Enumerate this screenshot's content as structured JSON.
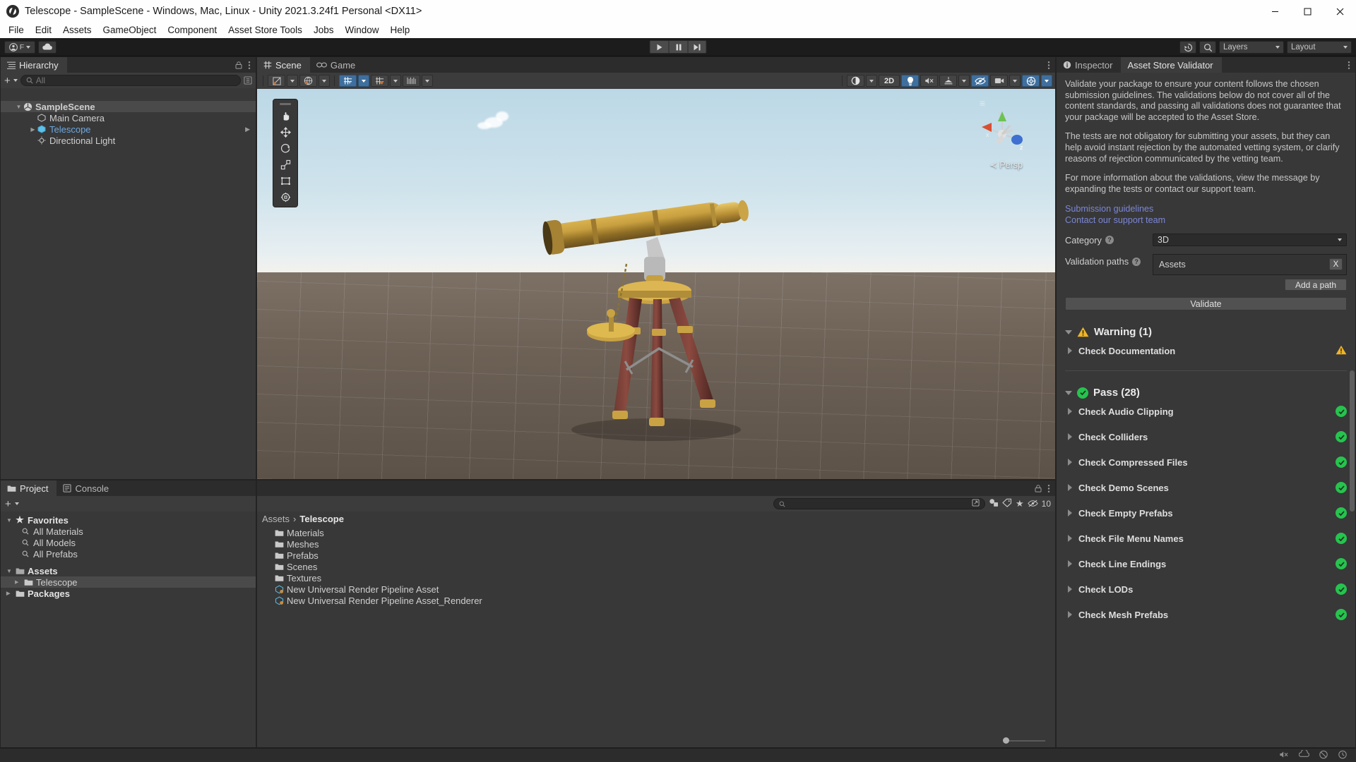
{
  "window": {
    "title": "Telescope - SampleScene - Windows, Mac, Linux - Unity 2021.3.24f1 Personal <DX11>",
    "logo_icon": "unity-logo-icon",
    "minimize_icon": "minimize-icon",
    "maximize_icon": "maximize-icon",
    "close_icon": "close-icon"
  },
  "menubar": {
    "items": [
      "File",
      "Edit",
      "Assets",
      "GameObject",
      "Component",
      "Asset Store Tools",
      "Jobs",
      "Window",
      "Help"
    ]
  },
  "toolbar": {
    "account_label": "F",
    "account_icon": "account-icon",
    "cloud_icon": "cloud-icon",
    "play_icon": "play-icon",
    "pause_icon": "pause-icon",
    "step_icon": "step-icon",
    "history_icon": "undo-history-icon",
    "search_icon": "search-icon",
    "layers_label": "Layers",
    "layout_label": "Layout"
  },
  "hierarchy": {
    "tab_label": "Hierarchy",
    "tab_icon": "hierarchy-icon",
    "lock_icon": "lock-icon",
    "menu_icon": "kebab-menu-icon",
    "add_icon": "plus-icon",
    "search_placeholder": "All",
    "search_icon": "search-icon",
    "items": [
      {
        "label": "SampleScene",
        "icon": "scene-icon",
        "depth": 0,
        "expanded": true,
        "selected": true,
        "blue": false
      },
      {
        "label": "Main Camera",
        "icon": "gameobject-icon",
        "depth": 1,
        "expanded": null,
        "selected": false,
        "blue": false
      },
      {
        "label": "Telescope",
        "icon": "prefab-icon",
        "depth": 1,
        "expanded": false,
        "selected": false,
        "blue": true
      },
      {
        "label": "Directional Light",
        "icon": "gameobject-icon",
        "depth": 1,
        "expanded": null,
        "selected": false,
        "blue": false
      }
    ]
  },
  "scene": {
    "tabs": [
      {
        "label": "Scene",
        "icon": "scene-grid-icon",
        "active": true
      },
      {
        "label": "Game",
        "icon": "game-icon",
        "active": false
      }
    ],
    "menu_icon": "kebab-menu-icon",
    "left_tools": [
      {
        "name": "draw-mode-icon",
        "dropdown": true,
        "active": false
      },
      {
        "name": "shading-globe-icon",
        "dropdown": true,
        "active": false
      },
      {
        "name": "grid-2d-y-icon",
        "dropdown": true,
        "active": true
      },
      {
        "name": "snap-grid-icon",
        "dropdown": true,
        "active": false
      },
      {
        "name": "grid-scale-icon",
        "dropdown": true,
        "active": false
      }
    ],
    "right_tools": [
      {
        "name": "gizmo-shading-icon",
        "label": "",
        "dropdown": true,
        "active": false
      },
      {
        "name": "toggle-2d-button",
        "label": "2D",
        "dropdown": false,
        "active": false
      },
      {
        "name": "scene-lighting-icon",
        "label": "",
        "dropdown": false,
        "active": true
      },
      {
        "name": "audio-mute-icon",
        "label": "",
        "dropdown": false,
        "active": false
      },
      {
        "name": "fx-effects-icon",
        "label": "",
        "dropdown": true,
        "active": false
      },
      {
        "name": "scene-visibility-icon",
        "label": "",
        "dropdown": false,
        "active": true
      },
      {
        "name": "camera-overlay-icon",
        "label": "",
        "dropdown": true,
        "active": false
      },
      {
        "name": "gizmos-toggle-icon",
        "label": "",
        "dropdown": true,
        "active": true
      }
    ],
    "tool_palette": [
      {
        "name": "hand-tool",
        "active": false
      },
      {
        "name": "move-tool",
        "active": false
      },
      {
        "name": "rotate-tool",
        "active": false
      },
      {
        "name": "scale-tool",
        "active": false
      },
      {
        "name": "rect-tool",
        "active": false
      },
      {
        "name": "transform-tool",
        "active": false
      }
    ],
    "gizmo": {
      "x_label": "x",
      "y_label": "y",
      "z_label": "z",
      "projection": "Persp"
    }
  },
  "project": {
    "tabs": [
      {
        "label": "Project",
        "icon": "folder-icon",
        "active": true
      },
      {
        "label": "Console",
        "icon": "console-icon",
        "active": false
      }
    ],
    "lock_icon": "lock-icon",
    "menu_icon": "kebab-menu-icon",
    "add_icon": "plus-icon",
    "search_placeholder": "",
    "search_icon": "search-icon",
    "filter_icons": [
      "save-search-icon",
      "filter-type-icon",
      "filter-label-icon",
      "favorite-star-icon",
      "visibility-icon"
    ],
    "hidden_count": "10",
    "tree": [
      {
        "label": "Favorites",
        "icon": "star-icon",
        "depth": 0,
        "bold": true,
        "expanded": true,
        "selected": false
      },
      {
        "label": "All Materials",
        "icon": "search-icon",
        "depth": 1,
        "bold": false,
        "expanded": null,
        "selected": false
      },
      {
        "label": "All Models",
        "icon": "search-icon",
        "depth": 1,
        "bold": false,
        "expanded": null,
        "selected": false
      },
      {
        "label": "All Prefabs",
        "icon": "search-icon",
        "depth": 1,
        "bold": false,
        "expanded": null,
        "selected": false
      },
      {
        "label": "Assets",
        "icon": "folder-open-icon",
        "depth": 0,
        "bold": true,
        "expanded": true,
        "selected": false
      },
      {
        "label": "Telescope",
        "icon": "folder-icon",
        "depth": 1,
        "bold": false,
        "expanded": false,
        "selected": true
      },
      {
        "label": "Packages",
        "icon": "folder-icon",
        "depth": 0,
        "bold": true,
        "expanded": false,
        "selected": false
      }
    ],
    "breadcrumb": [
      "Assets",
      "Telescope"
    ],
    "items": [
      {
        "label": "Materials",
        "icon": "folder-icon"
      },
      {
        "label": "Meshes",
        "icon": "folder-icon"
      },
      {
        "label": "Prefabs",
        "icon": "folder-icon"
      },
      {
        "label": "Scenes",
        "icon": "folder-icon"
      },
      {
        "label": "Textures",
        "icon": "folder-icon"
      },
      {
        "label": "New Universal Render Pipeline Asset",
        "icon": "render-pipeline-asset-icon"
      },
      {
        "label": "New Universal Render Pipeline Asset_Renderer",
        "icon": "render-pipeline-asset-icon"
      }
    ]
  },
  "inspector": {
    "tabs": [
      {
        "label": "Inspector",
        "icon": "info-icon",
        "active": false
      },
      {
        "label": "Asset Store Validator",
        "icon": "",
        "active": true
      }
    ],
    "menu_icon": "kebab-menu-icon",
    "description": [
      "Validate your package to ensure your content follows the chosen submission guidelines. The validations below do not cover all of the content standards, and passing all validations does not guarantee that your package will be accepted to the Asset Store.",
      "The tests are not obligatory for submitting your assets, but they can help avoid instant rejection by the automated vetting system, or clarify reasons of rejection communicated by the vetting team.",
      "For more information about the validations, view the message by expanding the tests or contact our support team."
    ],
    "links": [
      "Submission guidelines",
      "Contact our support team"
    ],
    "category_label": "Category",
    "category_value": "3D",
    "validation_paths_label": "Validation paths",
    "validation_paths": [
      "Assets"
    ],
    "remove_path_label": "X",
    "add_path_label": "Add a path",
    "validate_label": "Validate",
    "warning_group": {
      "label": "Warning (1)",
      "expanded": true,
      "icon": "warning-triangle-icon"
    },
    "warning_items": [
      {
        "label": "Check Documentation",
        "status": "warning"
      }
    ],
    "pass_group": {
      "label": "Pass (28)",
      "expanded": true,
      "icon": "check-circle-icon"
    },
    "pass_items": [
      {
        "label": "Check Audio Clipping",
        "status": "pass"
      },
      {
        "label": "Check Colliders",
        "status": "pass"
      },
      {
        "label": "Check Compressed Files",
        "status": "pass"
      },
      {
        "label": "Check Demo Scenes",
        "status": "pass"
      },
      {
        "label": "Check Empty Prefabs",
        "status": "pass"
      },
      {
        "label": "Check File Menu Names",
        "status": "pass"
      },
      {
        "label": "Check Line Endings",
        "status": "pass"
      },
      {
        "label": "Check LODs",
        "status": "pass"
      },
      {
        "label": "Check Mesh Prefabs",
        "status": "pass"
      }
    ]
  },
  "statusbar": {
    "icons": [
      "mute-audio-icon",
      "collab-icon",
      "error-pause-icon",
      "clock-icon"
    ]
  },
  "colors": {
    "warning": "#f0b429",
    "pass": "#26c44e",
    "accent_blue": "#3e6f9e",
    "link": "#7b86d6",
    "panel_bg": "#383838",
    "chrome_bg": "#2c2c2c"
  }
}
